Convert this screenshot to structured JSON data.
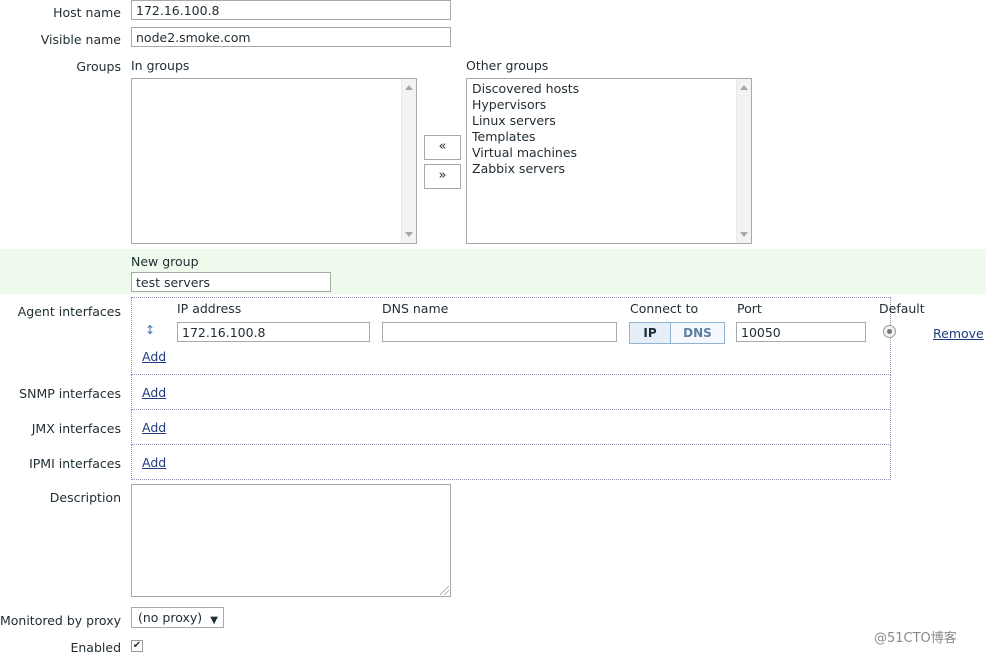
{
  "host": {
    "host_name_label": "Host name",
    "host_name_value": "172.16.100.8",
    "visible_name_label": "Visible name",
    "visible_name_value": "node2.smoke.com"
  },
  "groups": {
    "label": "Groups",
    "in_groups_label": "In groups",
    "other_groups_label": "Other groups",
    "in_groups": [],
    "other_groups": [
      "Discovered hosts",
      "Hypervisors",
      "Linux servers",
      "Templates",
      "Virtual machines",
      "Zabbix servers"
    ],
    "move_left_label": "«",
    "move_right_label": "»",
    "new_group_label": "New group",
    "new_group_value": "test servers"
  },
  "interfaces": {
    "agent_label": "Agent interfaces",
    "snmp_label": "SNMP interfaces",
    "jmx_label": "JMX interfaces",
    "ipmi_label": "IPMI interfaces",
    "columns": {
      "ip": "IP address",
      "dns": "DNS name",
      "connect": "Connect to",
      "port": "Port",
      "default": "Default"
    },
    "agent": {
      "ip": "172.16.100.8",
      "dns": "",
      "connect_ip": "IP",
      "connect_dns": "DNS",
      "connect_selected": "IP",
      "port": "10050",
      "remove": "Remove"
    },
    "add_label": "Add"
  },
  "description": {
    "label": "Description",
    "value": ""
  },
  "proxy": {
    "label": "Monitored by proxy",
    "value": "(no proxy)"
  },
  "enabled": {
    "label": "Enabled",
    "checked": true
  },
  "watermark": "@51CTO博客",
  "colors": {
    "new_group_band": "#eefaeb",
    "link": "#1f3a80",
    "segment_selected": "#e6eff8",
    "segment_unselected": "#f4f8fc"
  }
}
